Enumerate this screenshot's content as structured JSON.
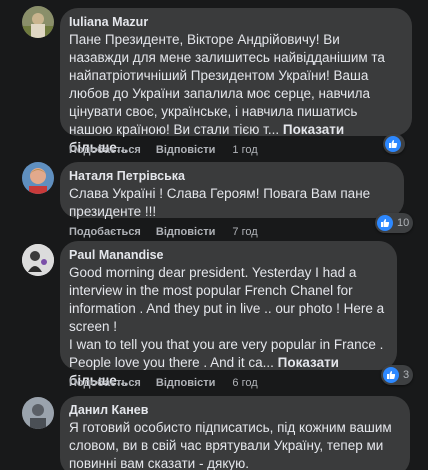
{
  "comments": [
    {
      "author": "Iuliana Mazur",
      "text": "Пане Президенте, Вікторе Андрійовичу! Ви назавжди для мене залишитесь найвідданішим та найпатріотичніший Президентом України! Ваша любов до України запалила моє серце, навчила цінувати своє, українське, і навчила пишатись нашою країною! Ви стали тією т...",
      "more": "Показати більше...",
      "like_label": "Подобається",
      "reply_label": "Відповісти",
      "time": "1 год",
      "reactions": ""
    },
    {
      "author": "Наталя Петрівська",
      "text": "Слава Україні ! Слава Героям! Повага Вам пане президенте !!!",
      "more": "",
      "like_label": "Подобається",
      "reply_label": "Відповісти",
      "time": "7 год",
      "reactions": "10"
    },
    {
      "author": "Paul Manandise",
      "text": "Good morning dear president. Yesterday I had a interview in the most popular French Chanel for information . And they put in live .. our photo ! Here a screen !\nI wan to tell you that you are very popular in France . People love you there . And it ca...",
      "more": "Показати більше...",
      "like_label": "Подобається",
      "reply_label": "Відповісти",
      "time": "6 год",
      "reactions": "3"
    },
    {
      "author": "Данил Канев",
      "text": "Я готовий особисто підписатись, під кожним вашим словом, ви в свій час врятували Україну, тепер ми повинні вам сказати - дякую.",
      "more": "",
      "like_label": "",
      "reply_label": "",
      "time": "",
      "reactions": ""
    }
  ]
}
